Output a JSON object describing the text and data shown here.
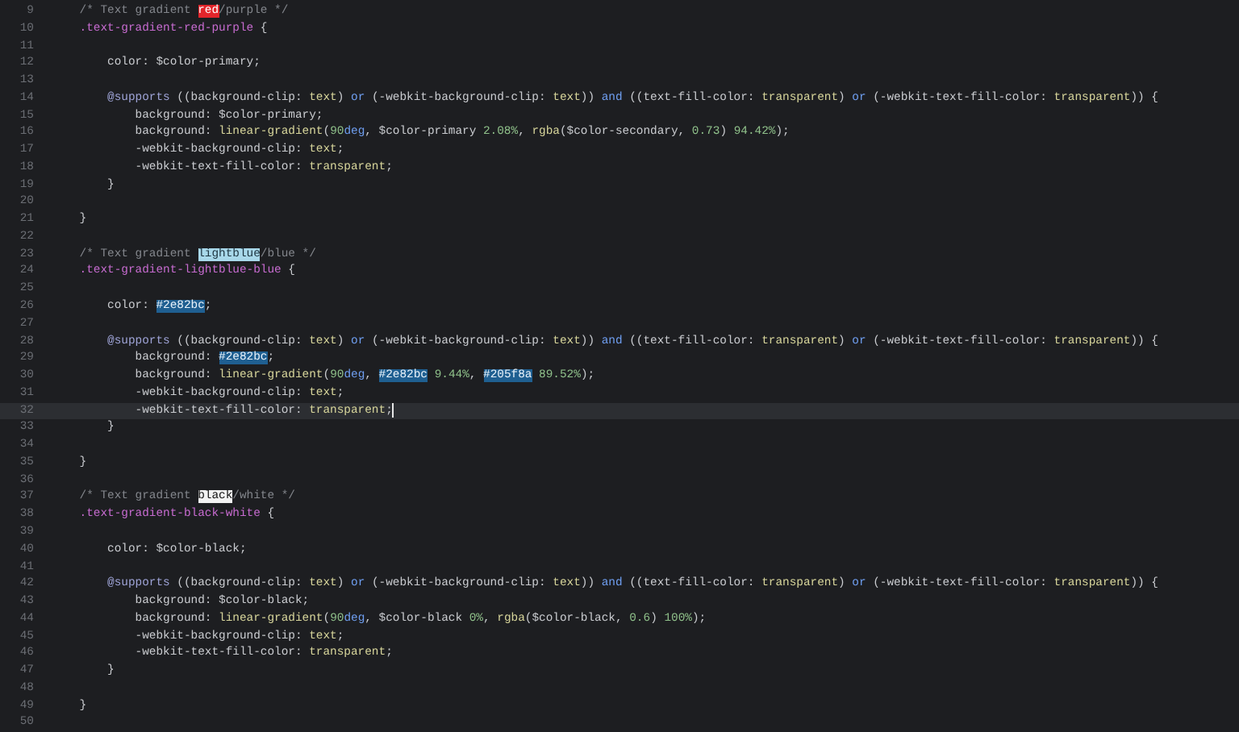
{
  "editor": {
    "lines": [
      {
        "number": "9",
        "current": false,
        "tokens": [
          {
            "kind": "comment",
            "text": "\t/* Text gradient "
          },
          {
            "kind": "mark_red",
            "text": "red"
          },
          {
            "kind": "comment",
            "text": "/purple */"
          }
        ]
      },
      {
        "number": "10",
        "current": false,
        "tokens": [
          {
            "kind": "selector",
            "text": "\t.text-gradient-red-purple"
          },
          {
            "kind": "plain",
            "text": " {"
          }
        ]
      },
      {
        "number": "11",
        "current": false
      },
      {
        "number": "12",
        "current": false,
        "tokens": [
          {
            "kind": "plain",
            "text": "\t\tcolor: $color-primary;"
          }
        ]
      },
      {
        "number": "13",
        "current": false
      },
      {
        "number": "14",
        "current": false,
        "tokens": [
          {
            "kind": "at_rule",
            "text": "\t\t@supports"
          },
          {
            "kind": "plain",
            "text": " ((background-clip: "
          },
          {
            "kind": "value",
            "text": "text"
          },
          {
            "kind": "plain",
            "text": ") "
          },
          {
            "kind": "keyword",
            "text": "or"
          },
          {
            "kind": "plain",
            "text": " (-webkit-background-clip: "
          },
          {
            "kind": "value",
            "text": "text"
          },
          {
            "kind": "plain",
            "text": ")) "
          },
          {
            "kind": "keyword",
            "text": "and"
          },
          {
            "kind": "plain",
            "text": " ((text-fill-color: "
          },
          {
            "kind": "value",
            "text": "transparent"
          },
          {
            "kind": "plain",
            "text": ") "
          },
          {
            "kind": "keyword",
            "text": "or"
          },
          {
            "kind": "plain",
            "text": " (-webkit-text-fill-color: "
          },
          {
            "kind": "value",
            "text": "transparent"
          },
          {
            "kind": "plain",
            "text": ")) {"
          }
        ]
      },
      {
        "number": "15",
        "current": false,
        "tokens": [
          {
            "kind": "plain",
            "text": "\t\t\tbackground: $color-primary;"
          }
        ]
      },
      {
        "number": "16",
        "current": false,
        "tokens": [
          {
            "kind": "plain",
            "text": "\t\t\tbackground: "
          },
          {
            "kind": "value",
            "text": "linear-gradient"
          },
          {
            "kind": "plain",
            "text": "("
          },
          {
            "kind": "number",
            "text": "90"
          },
          {
            "kind": "unit",
            "text": "deg"
          },
          {
            "kind": "plain",
            "text": ", $color-primary "
          },
          {
            "kind": "number",
            "text": "2.08%"
          },
          {
            "kind": "plain",
            "text": ", "
          },
          {
            "kind": "value",
            "text": "rgba"
          },
          {
            "kind": "plain",
            "text": "($color-secondary, "
          },
          {
            "kind": "number",
            "text": "0.73"
          },
          {
            "kind": "plain",
            "text": ") "
          },
          {
            "kind": "number",
            "text": "94.42%"
          },
          {
            "kind": "plain",
            "text": ");"
          }
        ]
      },
      {
        "number": "17",
        "current": false,
        "tokens": [
          {
            "kind": "plain",
            "text": "\t\t\t-webkit-background-clip: "
          },
          {
            "kind": "value",
            "text": "text"
          },
          {
            "kind": "plain",
            "text": ";"
          }
        ]
      },
      {
        "number": "18",
        "current": false,
        "tokens": [
          {
            "kind": "plain",
            "text": "\t\t\t-webkit-text-fill-color: "
          },
          {
            "kind": "value",
            "text": "transparent"
          },
          {
            "kind": "plain",
            "text": ";"
          }
        ]
      },
      {
        "number": "19",
        "current": false,
        "tokens": [
          {
            "kind": "plain",
            "text": "\t\t}"
          }
        ]
      },
      {
        "number": "20",
        "current": false
      },
      {
        "number": "21",
        "current": false,
        "tokens": [
          {
            "kind": "plain",
            "text": "\t}"
          }
        ]
      },
      {
        "number": "22",
        "current": false
      },
      {
        "number": "23",
        "current": false,
        "tokens": [
          {
            "kind": "comment",
            "text": "\t/* Text gradient "
          },
          {
            "kind": "mark_lightblue",
            "text": "lightblue"
          },
          {
            "kind": "comment",
            "text": "/blue */"
          }
        ]
      },
      {
        "number": "24",
        "current": false,
        "tokens": [
          {
            "kind": "selector",
            "text": "\t.text-gradient-lightblue-blue"
          },
          {
            "kind": "plain",
            "text": " {"
          }
        ]
      },
      {
        "number": "25",
        "current": false
      },
      {
        "number": "26",
        "current": false,
        "tokens": [
          {
            "kind": "plain",
            "text": "\t\tcolor: "
          },
          {
            "kind": "mark_blue",
            "text": "#2e82bc"
          },
          {
            "kind": "plain",
            "text": ";"
          }
        ]
      },
      {
        "number": "27",
        "current": false
      },
      {
        "number": "28",
        "current": false,
        "tokens": [
          {
            "kind": "at_rule",
            "text": "\t\t@supports"
          },
          {
            "kind": "plain",
            "text": " ((background-clip: "
          },
          {
            "kind": "value",
            "text": "text"
          },
          {
            "kind": "plain",
            "text": ") "
          },
          {
            "kind": "keyword",
            "text": "or"
          },
          {
            "kind": "plain",
            "text": " (-webkit-background-clip: "
          },
          {
            "kind": "value",
            "text": "text"
          },
          {
            "kind": "plain",
            "text": ")) "
          },
          {
            "kind": "keyword",
            "text": "and"
          },
          {
            "kind": "plain",
            "text": " ((text-fill-color: "
          },
          {
            "kind": "value",
            "text": "transparent"
          },
          {
            "kind": "plain",
            "text": ") "
          },
          {
            "kind": "keyword",
            "text": "or"
          },
          {
            "kind": "plain",
            "text": " (-webkit-text-fill-color: "
          },
          {
            "kind": "value",
            "text": "transparent"
          },
          {
            "kind": "plain",
            "text": ")) {"
          }
        ]
      },
      {
        "number": "29",
        "current": false,
        "tokens": [
          {
            "kind": "plain",
            "text": "\t\t\tbackground: "
          },
          {
            "kind": "mark_blue",
            "text": "#2e82bc"
          },
          {
            "kind": "plain",
            "text": ";"
          }
        ]
      },
      {
        "number": "30",
        "current": false,
        "tokens": [
          {
            "kind": "plain",
            "text": "\t\t\tbackground: "
          },
          {
            "kind": "value",
            "text": "linear-gradient"
          },
          {
            "kind": "plain",
            "text": "("
          },
          {
            "kind": "number",
            "text": "90"
          },
          {
            "kind": "unit",
            "text": "deg"
          },
          {
            "kind": "plain",
            "text": ", "
          },
          {
            "kind": "mark_blue",
            "text": "#2e82bc"
          },
          {
            "kind": "number",
            "text": " 9.44%"
          },
          {
            "kind": "plain",
            "text": ", "
          },
          {
            "kind": "mark_blue",
            "text": "#205f8a"
          },
          {
            "kind": "number",
            "text": " 89.52%"
          },
          {
            "kind": "plain",
            "text": ");"
          }
        ]
      },
      {
        "number": "31",
        "current": false,
        "tokens": [
          {
            "kind": "plain",
            "text": "\t\t\t-webkit-background-clip: "
          },
          {
            "kind": "value",
            "text": "text"
          },
          {
            "kind": "plain",
            "text": ";"
          }
        ]
      },
      {
        "number": "32",
        "current": true,
        "tokens": [
          {
            "kind": "plain",
            "text": "\t\t\t-webkit-text-fill-color: "
          },
          {
            "kind": "value",
            "text": "transparent"
          },
          {
            "kind": "plain",
            "text": ";"
          }
        ]
      },
      {
        "number": "33",
        "current": false,
        "tokens": [
          {
            "kind": "plain",
            "text": "\t\t}"
          }
        ]
      },
      {
        "number": "34",
        "current": false
      },
      {
        "number": "35",
        "current": false,
        "tokens": [
          {
            "kind": "plain",
            "text": "\t}"
          }
        ]
      },
      {
        "number": "36",
        "current": false
      },
      {
        "number": "37",
        "current": false,
        "tokens": [
          {
            "kind": "comment",
            "text": "\t/* Text gradient "
          },
          {
            "kind": "mark_white",
            "text": "black"
          },
          {
            "kind": "comment",
            "text": "/white */"
          }
        ]
      },
      {
        "number": "38",
        "current": false,
        "tokens": [
          {
            "kind": "selector",
            "text": "\t.text-gradient-black-white"
          },
          {
            "kind": "plain",
            "text": " {"
          }
        ]
      },
      {
        "number": "39",
        "current": false
      },
      {
        "number": "40",
        "current": false,
        "tokens": [
          {
            "kind": "plain",
            "text": "\t\tcolor: $color-black;"
          }
        ]
      },
      {
        "number": "41",
        "current": false
      },
      {
        "number": "42",
        "current": false,
        "tokens": [
          {
            "kind": "at_rule",
            "text": "\t\t@supports"
          },
          {
            "kind": "plain",
            "text": " ((background-clip: "
          },
          {
            "kind": "value",
            "text": "text"
          },
          {
            "kind": "plain",
            "text": ") "
          },
          {
            "kind": "keyword",
            "text": "or"
          },
          {
            "kind": "plain",
            "text": " (-webkit-background-clip: "
          },
          {
            "kind": "value",
            "text": "text"
          },
          {
            "kind": "plain",
            "text": ")) "
          },
          {
            "kind": "keyword",
            "text": "and"
          },
          {
            "kind": "plain",
            "text": " ((text-fill-color: "
          },
          {
            "kind": "value",
            "text": "transparent"
          },
          {
            "kind": "plain",
            "text": ") "
          },
          {
            "kind": "keyword",
            "text": "or"
          },
          {
            "kind": "plain",
            "text": " (-webkit-text-fill-color: "
          },
          {
            "kind": "value",
            "text": "transparent"
          },
          {
            "kind": "plain",
            "text": ")) {"
          }
        ]
      },
      {
        "number": "43",
        "current": false,
        "tokens": [
          {
            "kind": "plain",
            "text": "\t\t\tbackground: $color-black;"
          }
        ]
      },
      {
        "number": "44",
        "current": false,
        "tokens": [
          {
            "kind": "plain",
            "text": "\t\t\tbackground: "
          },
          {
            "kind": "value",
            "text": "linear-gradient"
          },
          {
            "kind": "plain",
            "text": "("
          },
          {
            "kind": "number",
            "text": "90"
          },
          {
            "kind": "unit",
            "text": "deg"
          },
          {
            "kind": "plain",
            "text": ", $color-black "
          },
          {
            "kind": "number",
            "text": "0%"
          },
          {
            "kind": "plain",
            "text": ", "
          },
          {
            "kind": "value",
            "text": "rgba"
          },
          {
            "kind": "plain",
            "text": "($color-black, "
          },
          {
            "kind": "number",
            "text": "0.6"
          },
          {
            "kind": "plain",
            "text": ") "
          },
          {
            "kind": "number",
            "text": "100%"
          },
          {
            "kind": "plain",
            "text": ");"
          }
        ]
      },
      {
        "number": "45",
        "current": false,
        "tokens": [
          {
            "kind": "plain",
            "text": "\t\t\t-webkit-background-clip: "
          },
          {
            "kind": "value",
            "text": "text"
          },
          {
            "kind": "plain",
            "text": ";"
          }
        ]
      },
      {
        "number": "46",
        "current": false,
        "tokens": [
          {
            "kind": "plain",
            "text": "\t\t\t-webkit-text-fill-color: "
          },
          {
            "kind": "value",
            "text": "transparent"
          },
          {
            "kind": "plain",
            "text": ";"
          }
        ]
      },
      {
        "number": "47",
        "current": false,
        "tokens": [
          {
            "kind": "plain",
            "text": "\t\t}"
          }
        ]
      },
      {
        "number": "48",
        "current": false
      },
      {
        "number": "49",
        "current": false,
        "tokens": [
          {
            "kind": "plain",
            "text": "\t}"
          }
        ]
      },
      {
        "number": "50",
        "current": false
      }
    ]
  }
}
